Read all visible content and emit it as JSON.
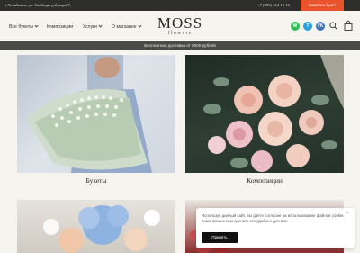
{
  "topbar": {
    "address": "г.Челябинск, ул. Свободы д.2, корп.7,",
    "phone": "+7 (993) 464-15-16",
    "cta_label": "Заказать букет"
  },
  "nav": {
    "items": [
      {
        "label": "Все букеты",
        "has_dropdown": true
      },
      {
        "label": "Композиции",
        "has_dropdown": false
      },
      {
        "label": "Услуги",
        "has_dropdown": true
      },
      {
        "label": "О магазине",
        "has_dropdown": true
      }
    ]
  },
  "logo": {
    "name": "MOSS",
    "sub": "flowers"
  },
  "social": {
    "whatsapp": "W",
    "telegram": "T",
    "vk": "VK"
  },
  "icons": {
    "search": "search-icon",
    "cart": "shopping-bag-icon"
  },
  "promo": {
    "text": "Бесплатная доставка от 8000 рублей"
  },
  "categories": [
    {
      "label": "Букеты"
    },
    {
      "label": "Композиции"
    }
  ],
  "cookie": {
    "text": "Используя данный сайт, вы даёте согласие на использование файлов cookie, помогающих нам сделать его удобнее для вас.",
    "accept_label": "Принять",
    "close_label": "×"
  },
  "colors": {
    "accent": "#e9542c",
    "topbar": "#2d2d2b",
    "promo_bar": "#4a4a46",
    "background": "#f6f4ee"
  }
}
